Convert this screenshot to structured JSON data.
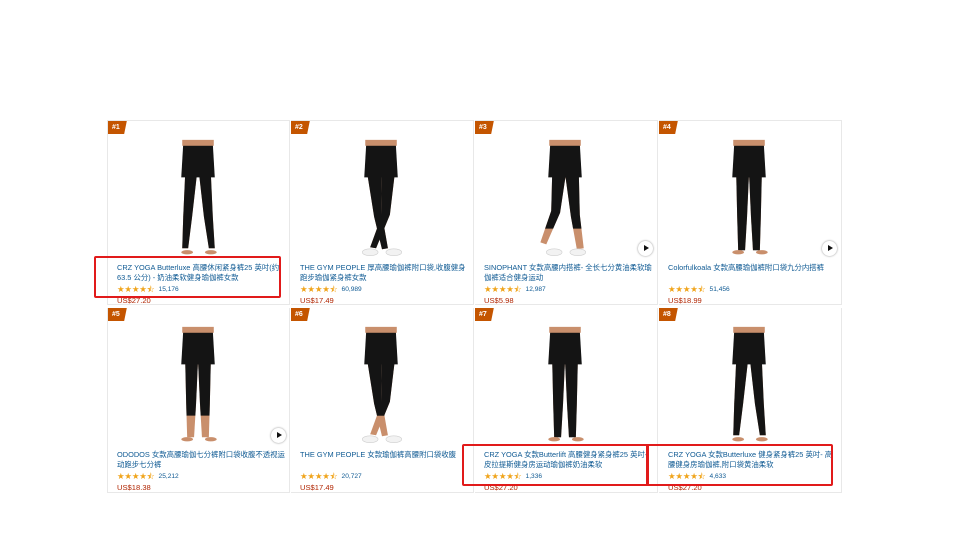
{
  "products": [
    {
      "rank": "#1",
      "title": "CRZ YOGA Butterluxe 高腰休闲紧身裤25 英吋(约63.5 公分) - 奶油柔软健身瑜伽裤女款",
      "stars": "★★★★⯪",
      "reviews": "15,176",
      "price": "US$27.20",
      "has_video": false,
      "highlighted": true
    },
    {
      "rank": "#2",
      "title": "THE GYM PEOPLE 厚高腰瑜伽裤附口袋,收腹健身跑步瑜伽紧身裤女款",
      "stars": "★★★★⯪",
      "reviews": "60,989",
      "price": "US$17.49",
      "has_video": false,
      "highlighted": false
    },
    {
      "rank": "#3",
      "title": "SINOPHANT 女款高腰内搭裤- 全长七分黄油柔软瑜伽裤适合健身运动",
      "stars": "★★★★⯪",
      "reviews": "12,987",
      "price": "US$5.98",
      "has_video": true,
      "highlighted": false
    },
    {
      "rank": "#4",
      "title": "Colorfulkoala 女款高腰瑜伽裤附口袋九分内搭裤",
      "stars": "★★★★⯪",
      "reviews": "51,456",
      "price": "US$18.99",
      "has_video": true,
      "highlighted": false
    },
    {
      "rank": "#5",
      "title": "ODODOS 女款高腰瑜伽七分裤附口袋收腹不透视运动跑步七分裤",
      "stars": "★★★★⯪",
      "reviews": "25,212",
      "price": "US$18.38",
      "has_video": true,
      "highlighted": false
    },
    {
      "rank": "#6",
      "title": "THE GYM PEOPLE 女款瑜伽裤高腰附口袋收腹",
      "stars": "★★★★⯪",
      "reviews": "20,727",
      "price": "US$17.49",
      "has_video": false,
      "highlighted": false
    },
    {
      "rank": "#7",
      "title": "CRZ YOGA 女款Butterlift 高腰健身紧身裤25 英吋- 皮拉提斯健身房运动瑜伽裤奶油柔软",
      "stars": "★★★★⯪",
      "reviews": "1,336",
      "price": "US$27.20",
      "has_video": false,
      "highlighted": true
    },
    {
      "rank": "#8",
      "title": "CRZ YOGA 女款Butterluxe 健身紧身裤25 英吋- 高腰健身房瑜伽裤,附口袋黄油柔软",
      "stars": "★★★★⯪",
      "reviews": "4,633",
      "price": "US$27.20",
      "has_video": false,
      "highlighted": true
    }
  ],
  "colors": {
    "rank_badge": "#c45500",
    "link": "#0f5a93",
    "price": "#b12704",
    "star": "#f0a41b",
    "highlight": "#e11a1a"
  },
  "icons": {
    "rank": "rank-badge",
    "video": "play-icon",
    "rating": "star-icon"
  }
}
